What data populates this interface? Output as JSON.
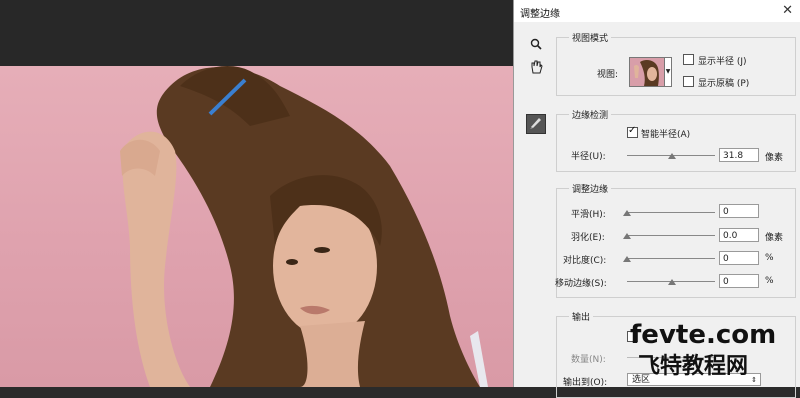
{
  "dialog": {
    "title": "调整边缘",
    "close_glyph": "✕"
  },
  "tools": {
    "zoom_glyph": "🔍",
    "hand_glyph": "✋",
    "brush_glyph": "✎"
  },
  "view_mode": {
    "legend": "视图模式",
    "view_label": "视图:",
    "show_radius": "显示半径 (J)",
    "show_original": "显示原稿 (P)"
  },
  "edge_detection": {
    "legend": "边缘检测",
    "smart_radius": "智能半径(A)",
    "radius_label": "半径(U):",
    "radius_value": "31.8",
    "radius_unit": "像素"
  },
  "adjust_edge": {
    "legend": "调整边缘",
    "smooth_label": "平滑(H):",
    "smooth_value": "0",
    "feather_label": "羽化(E):",
    "feather_value": "0.0",
    "feather_unit": "像素",
    "contrast_label": "对比度(C):",
    "contrast_value": "0",
    "contrast_unit": "%",
    "shift_label": "移动边缘(S):",
    "shift_value": "0",
    "shift_unit": "%"
  },
  "output": {
    "legend": "输出",
    "amount_label": "数量(N):",
    "output_to_label": "输出到(O):",
    "output_to_value": "选区"
  },
  "watermark": {
    "line1": "fevte.com",
    "line2": "飞特教程网"
  }
}
